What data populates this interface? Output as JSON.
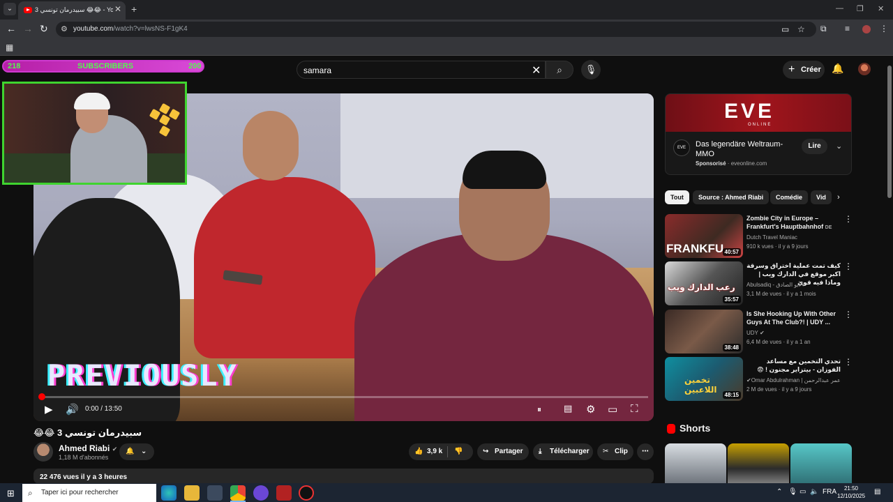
{
  "browser": {
    "tab_title": "سبيدرمان تونسي 3 😂😂 - YouTube",
    "url_main": "youtube.com",
    "url_path": "/watch?v=lwsNS-F1gK4"
  },
  "overlay": {
    "left_count": "218",
    "label": "SUBSCRIBERS",
    "right_count": "200"
  },
  "header": {
    "search_query": "samara",
    "create_label": "Créer"
  },
  "video": {
    "overlay_text": "PREVIOUSLY",
    "time": "0:00 / 13:50",
    "progress_fraction": 0.003,
    "title": "سبيدرمان تونسي 3 😂😂"
  },
  "channel": {
    "name": "Ahmed Riabi",
    "subscribers": "1,18 M d'abonnés"
  },
  "actions": {
    "likes": "3,9 k",
    "share": "Partager",
    "download": "Télécharger",
    "clip": "Clip"
  },
  "description": {
    "summary": "22 476 vues  il y a 3 heures"
  },
  "ad": {
    "logo": "EVE",
    "logo_sub": "ONLINE",
    "title": "Das legendäre Weltraum-MMO",
    "sponsored": "Sponsorisé",
    "domain": "eveonline.com",
    "button": "Lire"
  },
  "chips": [
    "Tout",
    "Source : Ahmed Riabi",
    "Comédie",
    "Vid"
  ],
  "recommendations": [
    {
      "title": "Zombie City in Europe – Frankfurt's Hauptbahnhof",
      "badge": "DE",
      "channel": "Dutch Travel Maniac",
      "meta": "910 k vues · il y a 9 jours",
      "duration": "40:57",
      "thumb_text": "FRANKFU"
    },
    {
      "title": "كيف تمت عملية اختراق وسرقة اكبر موقع في الدارك ويب | وماذا فيه قوي",
      "channel": "Abulsadiq - أبو الصادق",
      "meta": "3,1 M de vues · il y a 1 mois",
      "duration": "35:57",
      "thumb_text": "رعب الدارك ويب"
    },
    {
      "title": "Is She Hooking Up With Other Guys At The Club?! | UDY ...",
      "channel": "UDY",
      "meta": "6,4 M de vues · il y a 1 an",
      "duration": "38:48",
      "thumb_text": ""
    },
    {
      "title": "تحدي التخمين مع مساعد الفوزان - بيتزاير مجنون ! 😨",
      "channel": "Omar Abdulrahman | عمر عبدالرحمن",
      "meta": "2 M de vues · il y a 9 jours",
      "duration": "48:15",
      "thumb_text": "تخمين اللاعبين"
    }
  ],
  "shorts": {
    "title": "Shorts"
  },
  "taskbar": {
    "search_placeholder": "Taper ici pour rechercher",
    "lang": "FRA",
    "time": "21:50",
    "date": "12/10/2025"
  },
  "colors": {
    "accent_red": "#ff0000",
    "webcam_border": "#3fd42f",
    "sub_bar": "#cf3ad0",
    "sub_text": "#56f74f"
  }
}
